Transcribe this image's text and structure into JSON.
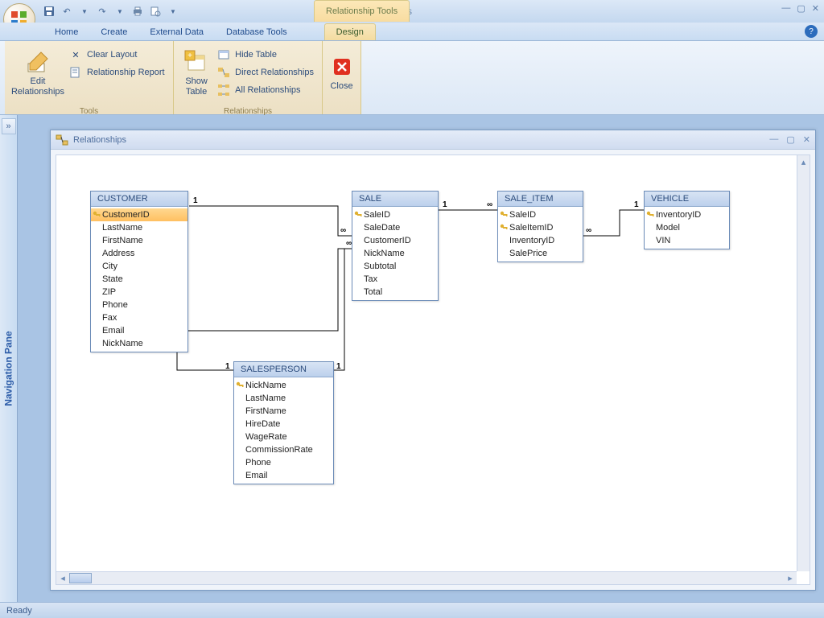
{
  "app": {
    "title": "Microsoft Access",
    "context_tab": "Relationship Tools"
  },
  "tabs": {
    "home": "Home",
    "create": "Create",
    "external": "External Data",
    "dbtools": "Database Tools",
    "design": "Design"
  },
  "ribbon": {
    "edit_rel": "Edit\nRelationships",
    "clear_layout": "Clear Layout",
    "rel_report": "Relationship Report",
    "tools_label": "Tools",
    "show_table": "Show\nTable",
    "hide_table": "Hide Table",
    "direct_rel": "Direct Relationships",
    "all_rel": "All Relationships",
    "relationships_label": "Relationships",
    "close": "Close"
  },
  "nav_pane": "Navigation Pane",
  "doc": {
    "title": "Relationships"
  },
  "entities": {
    "customer": {
      "title": "CUSTOMER",
      "fields": [
        "CustomerID",
        "LastName",
        "FirstName",
        "Address",
        "City",
        "State",
        "ZIP",
        "Phone",
        "Fax",
        "Email",
        "NickName"
      ],
      "keys": [
        0
      ],
      "selected": 0
    },
    "sale": {
      "title": "SALE",
      "fields": [
        "SaleID",
        "SaleDate",
        "CustomerID",
        "NickName",
        "Subtotal",
        "Tax",
        "Total"
      ],
      "keys": [
        0
      ]
    },
    "saleitem": {
      "title": "SALE_ITEM",
      "fields": [
        "SaleID",
        "SaleItemID",
        "InventoryID",
        "SalePrice"
      ],
      "keys": [
        0,
        1
      ]
    },
    "vehicle": {
      "title": "VEHICLE",
      "fields": [
        "InventoryID",
        "Model",
        "VIN"
      ],
      "keys": [
        0
      ]
    },
    "salesperson": {
      "title": "SALESPERSON",
      "fields": [
        "NickName",
        "LastName",
        "FirstName",
        "HireDate",
        "WageRate",
        "CommissionRate",
        "Phone",
        "Email"
      ],
      "keys": [
        0
      ]
    }
  },
  "labels": {
    "one": "1",
    "many": "∞"
  },
  "status": "Ready"
}
